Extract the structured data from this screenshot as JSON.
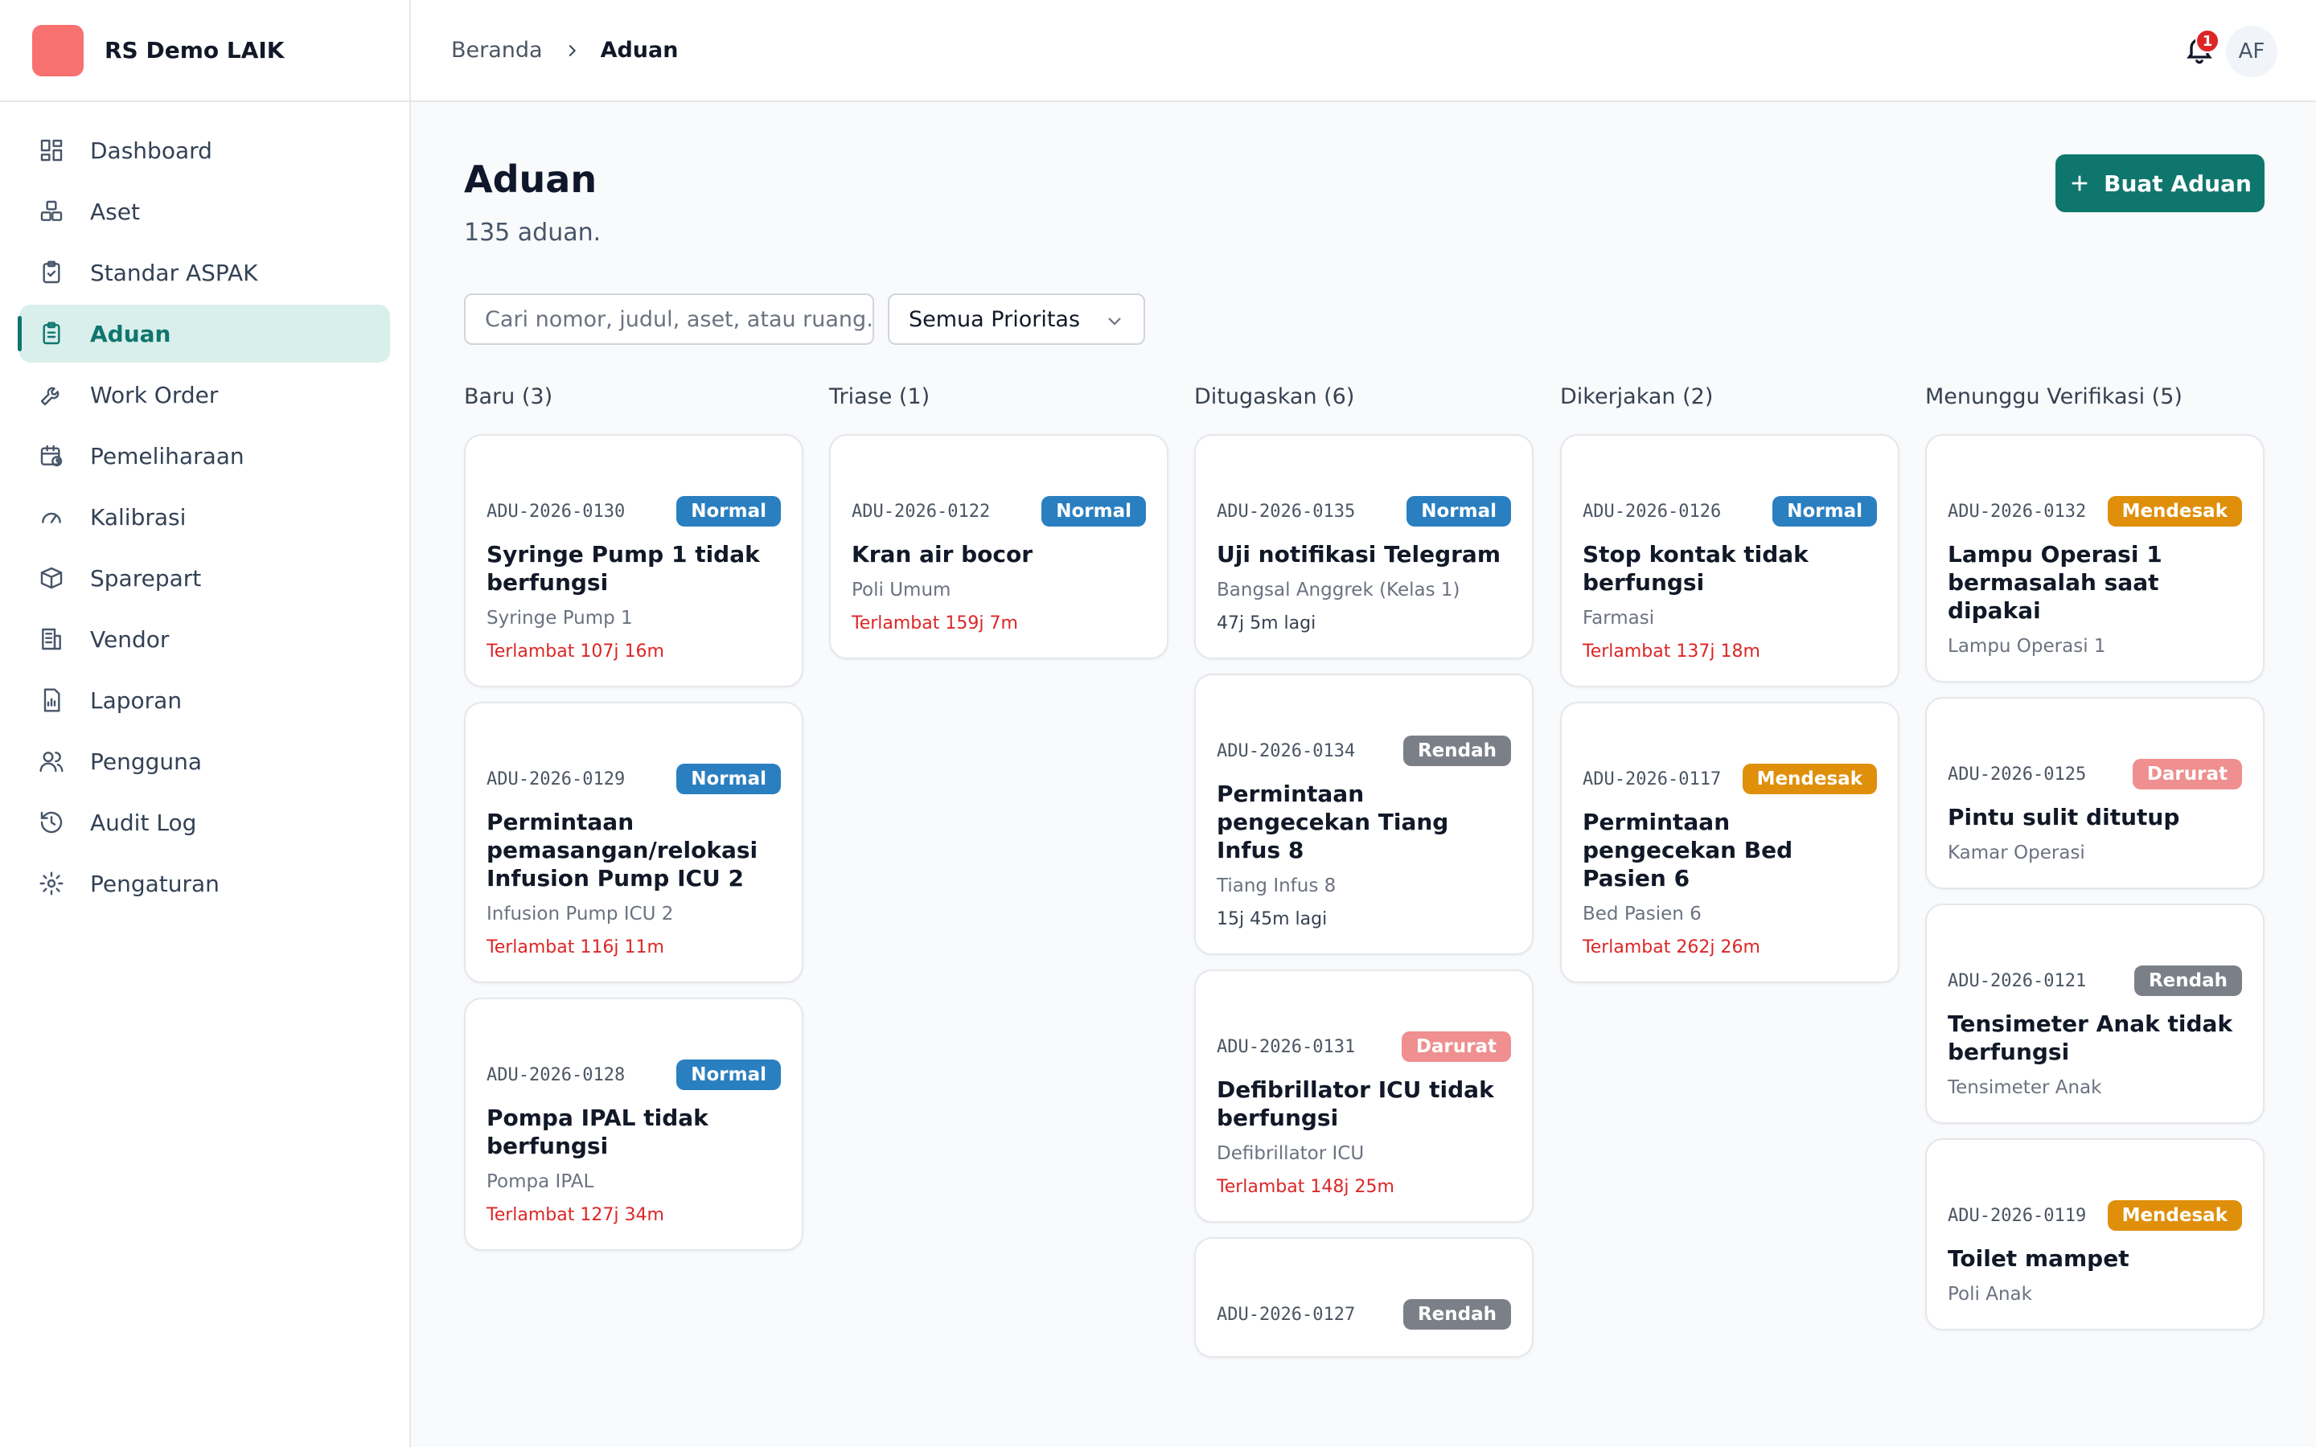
{
  "brand": {
    "name": "RS Demo LAIK",
    "logo_color": "#f87171"
  },
  "sidebar": {
    "items": [
      {
        "label": "Dashboard",
        "icon": "dashboard-icon",
        "active": false
      },
      {
        "label": "Aset",
        "icon": "boxes-icon",
        "active": false
      },
      {
        "label": "Standar ASPAK",
        "icon": "clipboard-check-icon",
        "active": false
      },
      {
        "label": "Aduan",
        "icon": "clipboard-list-icon",
        "active": true
      },
      {
        "label": "Work Order",
        "icon": "wrench-icon",
        "active": false
      },
      {
        "label": "Pemeliharaan",
        "icon": "calendar-clock-icon",
        "active": false
      },
      {
        "label": "Kalibrasi",
        "icon": "gauge-icon",
        "active": false
      },
      {
        "label": "Sparepart",
        "icon": "package-icon",
        "active": false
      },
      {
        "label": "Vendor",
        "icon": "building-icon",
        "active": false
      },
      {
        "label": "Laporan",
        "icon": "report-icon",
        "active": false
      },
      {
        "label": "Pengguna",
        "icon": "users-icon",
        "active": false
      },
      {
        "label": "Audit Log",
        "icon": "history-icon",
        "active": false
      },
      {
        "label": "Pengaturan",
        "icon": "gear-icon",
        "active": false
      }
    ]
  },
  "topbar": {
    "breadcrumb_home": "Beranda",
    "breadcrumb_current": "Aduan",
    "notification_count": "1",
    "avatar_initials": "AF"
  },
  "page": {
    "title": "Aduan",
    "subtitle": "135 aduan.",
    "create_button": "Buat Aduan",
    "search_placeholder": "Cari nomor, judul, aset, atau ruang...",
    "priority_filter": "Semua Prioritas"
  },
  "colors": {
    "accent": "#0f766e",
    "Normal": "#2a7fc0",
    "Rendah": "#7b8088",
    "Mendesak": "#df8f0a",
    "Darurat": "#ef8f8f"
  },
  "columns": [
    {
      "title": "Baru (3)",
      "cards": [
        {
          "id": "ADU-2026-0130",
          "priority": "Normal",
          "title": "Syringe Pump 1 tidak berfungsi",
          "location": "Syringe Pump 1",
          "sla": "Terlambat 107j 16m",
          "late": true
        },
        {
          "id": "ADU-2026-0129",
          "priority": "Normal",
          "title": "Permintaan pemasangan/relokasi Infusion Pump ICU 2",
          "location": "Infusion Pump ICU 2",
          "sla": "Terlambat 116j 11m",
          "late": true
        },
        {
          "id": "ADU-2026-0128",
          "priority": "Normal",
          "title": "Pompa IPAL tidak berfungsi",
          "location": "Pompa IPAL",
          "sla": "Terlambat 127j 34m",
          "late": true
        }
      ]
    },
    {
      "title": "Triase (1)",
      "cards": [
        {
          "id": "ADU-2026-0122",
          "priority": "Normal",
          "title": "Kran air bocor",
          "location": "Poli Umum",
          "sla": "Terlambat 159j 7m",
          "late": true
        }
      ]
    },
    {
      "title": "Ditugaskan (6)",
      "cards": [
        {
          "id": "ADU-2026-0135",
          "priority": "Normal",
          "title": "Uji notifikasi Telegram",
          "location": "Bangsal Anggrek (Kelas 1)",
          "sla": "47j 5m lagi",
          "late": false
        },
        {
          "id": "ADU-2026-0134",
          "priority": "Rendah",
          "title": "Permintaan pengecekan Tiang Infus 8",
          "location": "Tiang Infus 8",
          "sla": "15j 45m lagi",
          "late": false
        },
        {
          "id": "ADU-2026-0131",
          "priority": "Darurat",
          "title": "Defibrillator ICU tidak berfungsi",
          "location": "Defibrillator ICU",
          "sla": "Terlambat 148j 25m",
          "late": true
        },
        {
          "id": "ADU-2026-0127",
          "priority": "Rendah",
          "title": "",
          "location": "",
          "sla": "",
          "late": false
        }
      ]
    },
    {
      "title": "Dikerjakan (2)",
      "cards": [
        {
          "id": "ADU-2026-0126",
          "priority": "Normal",
          "title": "Stop kontak tidak berfungsi",
          "location": "Farmasi",
          "sla": "Terlambat 137j 18m",
          "late": true
        },
        {
          "id": "ADU-2026-0117",
          "priority": "Mendesak",
          "title": "Permintaan pengecekan Bed Pasien 6",
          "location": "Bed Pasien 6",
          "sla": "Terlambat 262j 26m",
          "late": true
        }
      ]
    },
    {
      "title": "Menunggu Verifikasi (5)",
      "cards": [
        {
          "id": "ADU-2026-0132",
          "priority": "Mendesak",
          "title": "Lampu Operasi 1 bermasalah saat dipakai",
          "location": "Lampu Operasi 1",
          "sla": "",
          "late": false
        },
        {
          "id": "ADU-2026-0125",
          "priority": "Darurat",
          "title": "Pintu sulit ditutup",
          "location": "Kamar Operasi",
          "sla": "",
          "late": false
        },
        {
          "id": "ADU-2026-0121",
          "priority": "Rendah",
          "title": "Tensimeter Anak tidak berfungsi",
          "location": "Tensimeter Anak",
          "sla": "",
          "late": false
        },
        {
          "id": "ADU-2026-0119",
          "priority": "Mendesak",
          "title": "Toilet mampet",
          "location": "Poli Anak",
          "sla": "",
          "late": false
        }
      ]
    }
  ]
}
